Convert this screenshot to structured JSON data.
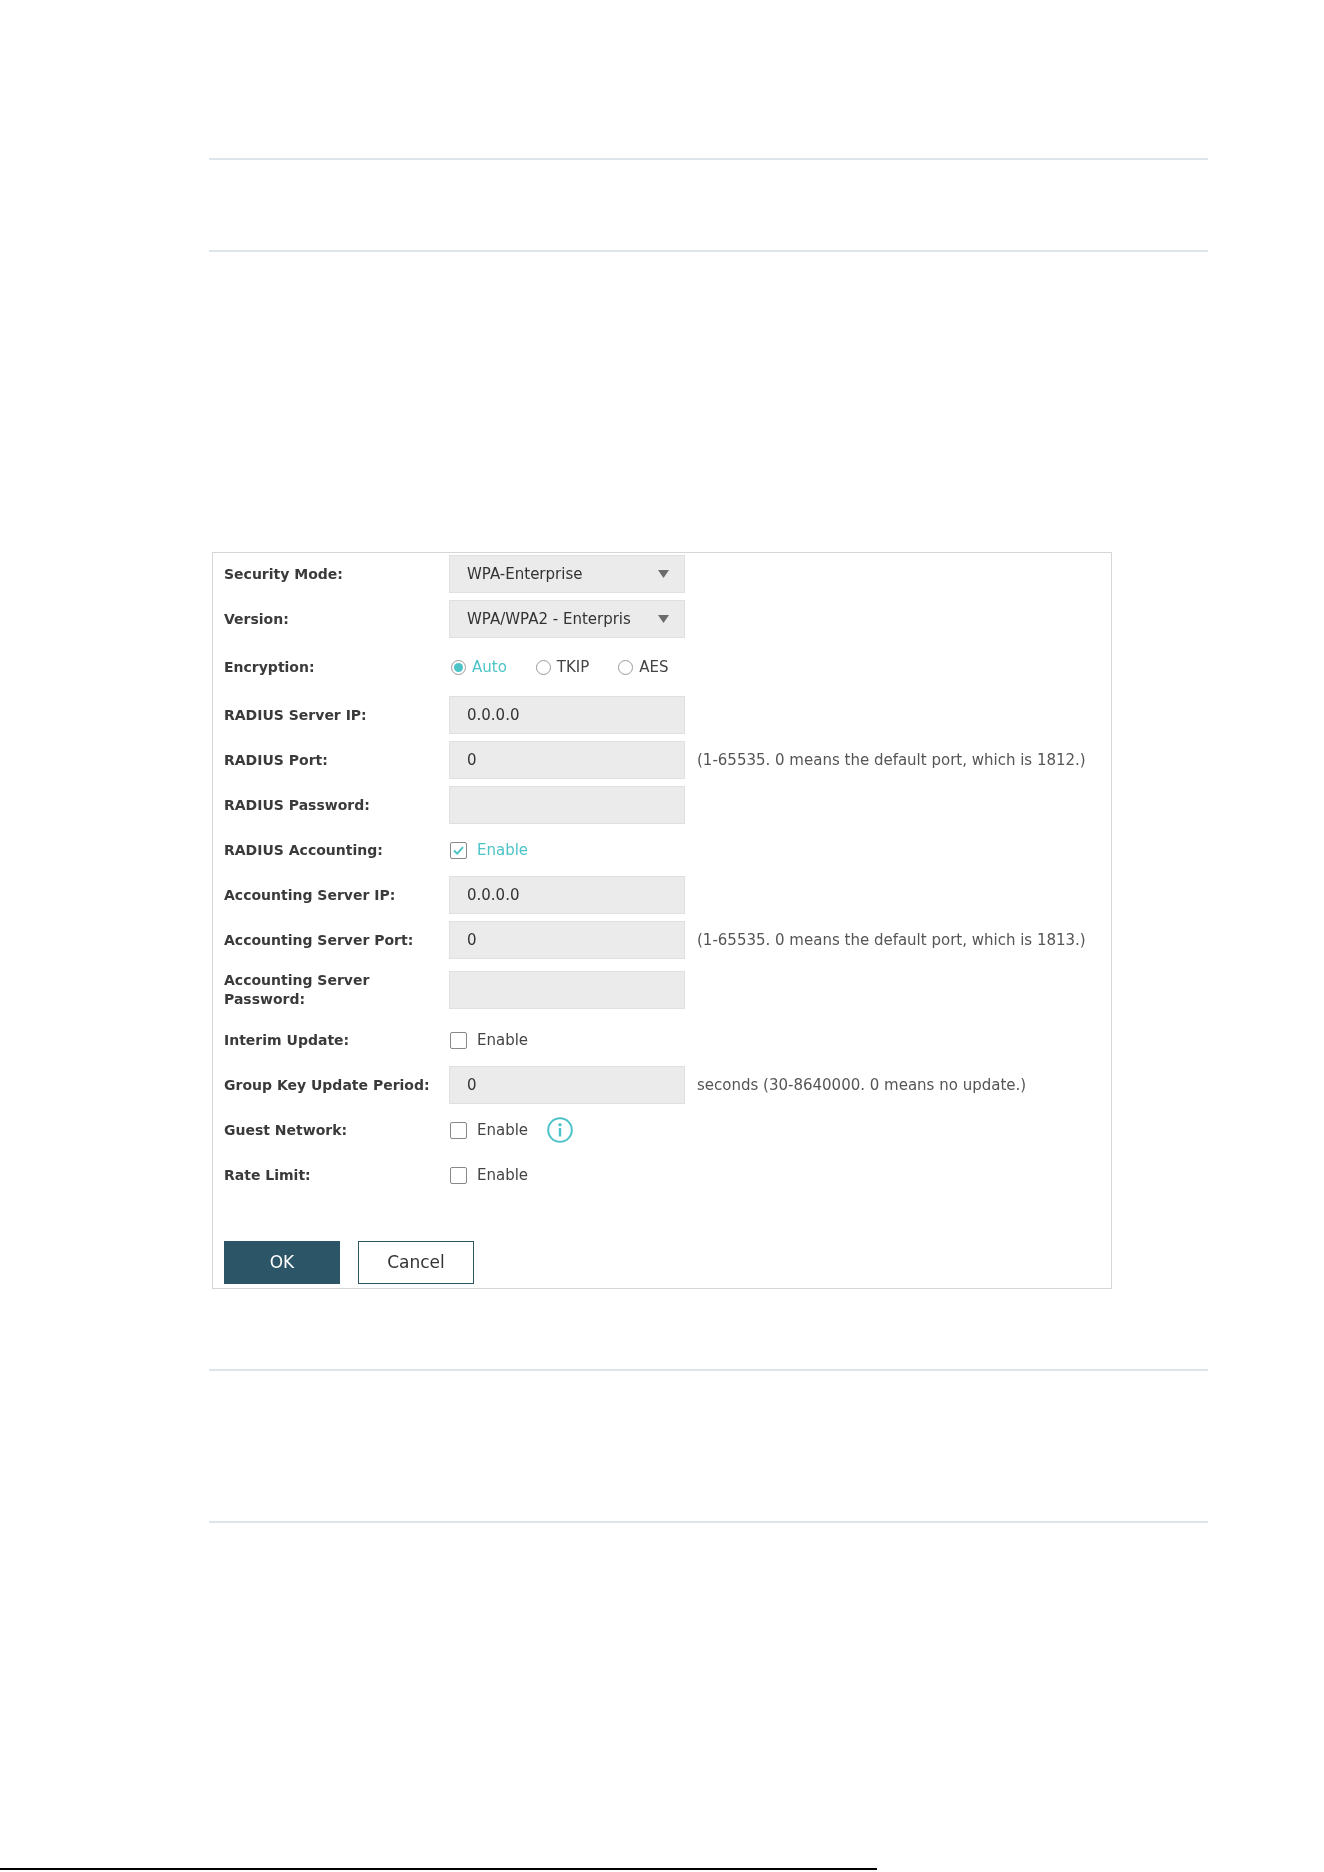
{
  "form": {
    "rows": [
      {
        "label": "Security Mode:",
        "kind": "select",
        "value": "WPA-Enterprise"
      },
      {
        "label": "Version:",
        "kind": "select",
        "value": "WPA/WPA2 - Enterpris"
      },
      {
        "label": "Encryption:",
        "kind": "radio",
        "options": [
          {
            "label": "Auto",
            "selected": true
          },
          {
            "label": "TKIP",
            "selected": false
          },
          {
            "label": "AES",
            "selected": false
          }
        ]
      },
      {
        "label": "RADIUS Server IP:",
        "kind": "text",
        "value": "0.0.0.0"
      },
      {
        "label": "RADIUS Port:",
        "kind": "text",
        "value": "0",
        "hint": "(1-65535. 0 means the default port, which is 1812.)"
      },
      {
        "label": "RADIUS Password:",
        "kind": "text"
      },
      {
        "label": "RADIUS Accounting:",
        "kind": "checkbox",
        "option": "Enable",
        "checked": true
      },
      {
        "label": "Accounting Server IP:",
        "kind": "text",
        "value": "0.0.0.0"
      },
      {
        "label": "Accounting Server Port:",
        "kind": "text",
        "value": "0",
        "hint": "(1-65535. 0 means the default port, which is 1813.)"
      },
      {
        "label": "Accounting Server Password:",
        "kind": "text"
      },
      {
        "label": "Interim Update:",
        "kind": "checkbox",
        "option": "Enable",
        "checked": false
      },
      {
        "label": "Group Key Update Period:",
        "kind": "text",
        "value": "0",
        "hint": "seconds (30-8640000. 0 means no update.)"
      },
      {
        "label": "Guest Network:",
        "kind": "checkbox",
        "option": "Enable",
        "checked": false,
        "info": true
      },
      {
        "label": "Rate Limit:",
        "kind": "checkbox",
        "option": "Enable",
        "checked": false
      }
    ]
  },
  "buttons": [
    {
      "label": "OK",
      "kind": "primary"
    },
    {
      "label": "Cancel",
      "kind": "secondary"
    }
  ]
}
